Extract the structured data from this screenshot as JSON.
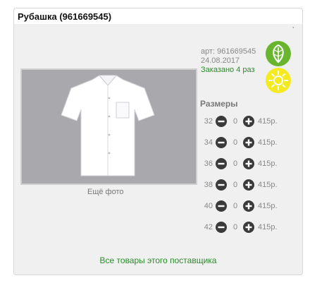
{
  "product": {
    "title": "Рубашка (961669545)",
    "tick_mark": ","
  },
  "meta": {
    "article": "арт: 961669545",
    "date": "24.08.2017",
    "ordered": "Заказано 4 раз"
  },
  "badges": [
    {
      "icon": "leaf-icon",
      "color": "#6ab52e"
    },
    {
      "icon": "sun-icon",
      "color": "#f4ea1f"
    }
  ],
  "gallery": {
    "more_photos": "Ещё фото"
  },
  "sizes": {
    "heading": "Размеры",
    "rows": [
      {
        "size": "32",
        "qty": "0",
        "price": "415р."
      },
      {
        "size": "34",
        "qty": "0",
        "price": "415р."
      },
      {
        "size": "36",
        "qty": "0",
        "price": "415р."
      },
      {
        "size": "38",
        "qty": "0",
        "price": "415р."
      },
      {
        "size": "40",
        "qty": "0",
        "price": "415р."
      },
      {
        "size": "42",
        "qty": "0",
        "price": "415р."
      }
    ]
  },
  "footer": {
    "supplier_link": "Все товары этого поставщика"
  },
  "colors": {
    "accent_green": "#2c8a2c",
    "button_dark": "#3a3a3a"
  }
}
